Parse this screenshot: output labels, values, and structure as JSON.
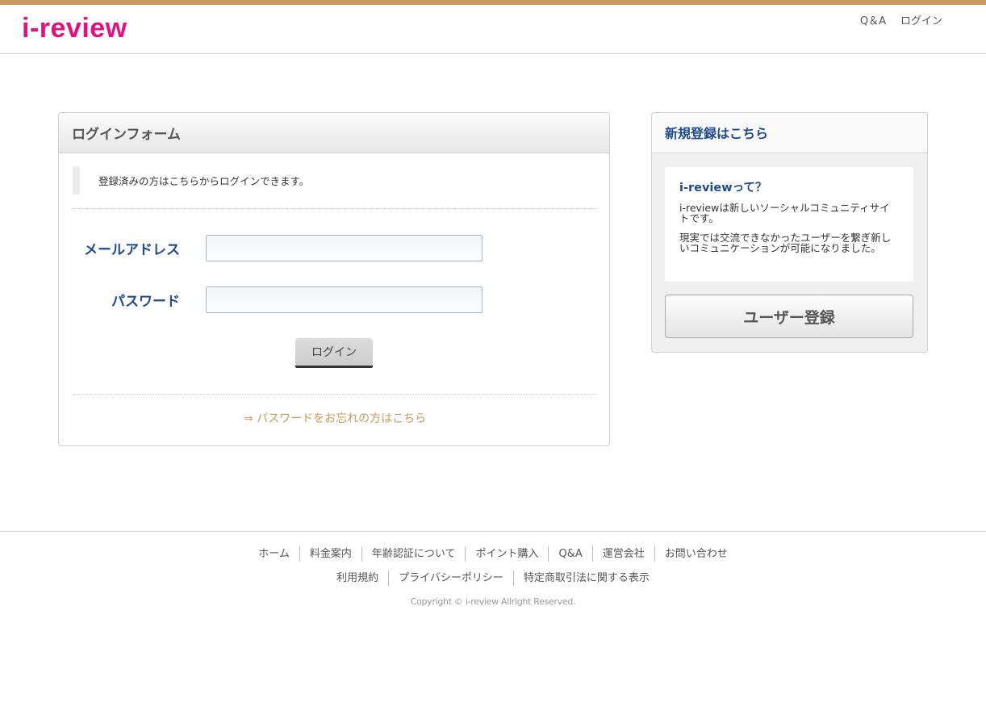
{
  "brand": {
    "logo": "i-review",
    "accent": "#e0127f",
    "topbar_color": "#c89a66"
  },
  "header_nav": [
    {
      "label": "Q＆A"
    },
    {
      "label": "ログイン"
    }
  ],
  "login_form": {
    "title": "ログインフォーム",
    "note": "登録済みの方はこちらからログインできます。",
    "email_label": "メールアドレス",
    "email_value": "",
    "password_label": "パスワード",
    "password_value": "",
    "submit_label": "ログイン",
    "forgot_link": "⇒ パスワードをお忘れの方はこちら"
  },
  "register": {
    "title": "新規登録はこちら",
    "about_title": "i-reviewって？",
    "about_p1": "i-reviewは新しいソーシャルコミュニティサイトです。",
    "about_p2": "現実では交流できなかったユーザーを繋ぎ新しいコミュニケーションが可能になりました。",
    "button_label": "ユーザー登録"
  },
  "footer": {
    "row1": [
      "ホーム",
      "料金案内",
      "年齢認証について",
      "ポイント購入",
      "Q&A",
      "運営会社",
      "お問い合わせ"
    ],
    "row2": [
      "利用規約",
      "プライバシーポリシー",
      "特定商取引法に関する表示"
    ],
    "copyright": "Copyright © i-review Allright Reserved."
  }
}
